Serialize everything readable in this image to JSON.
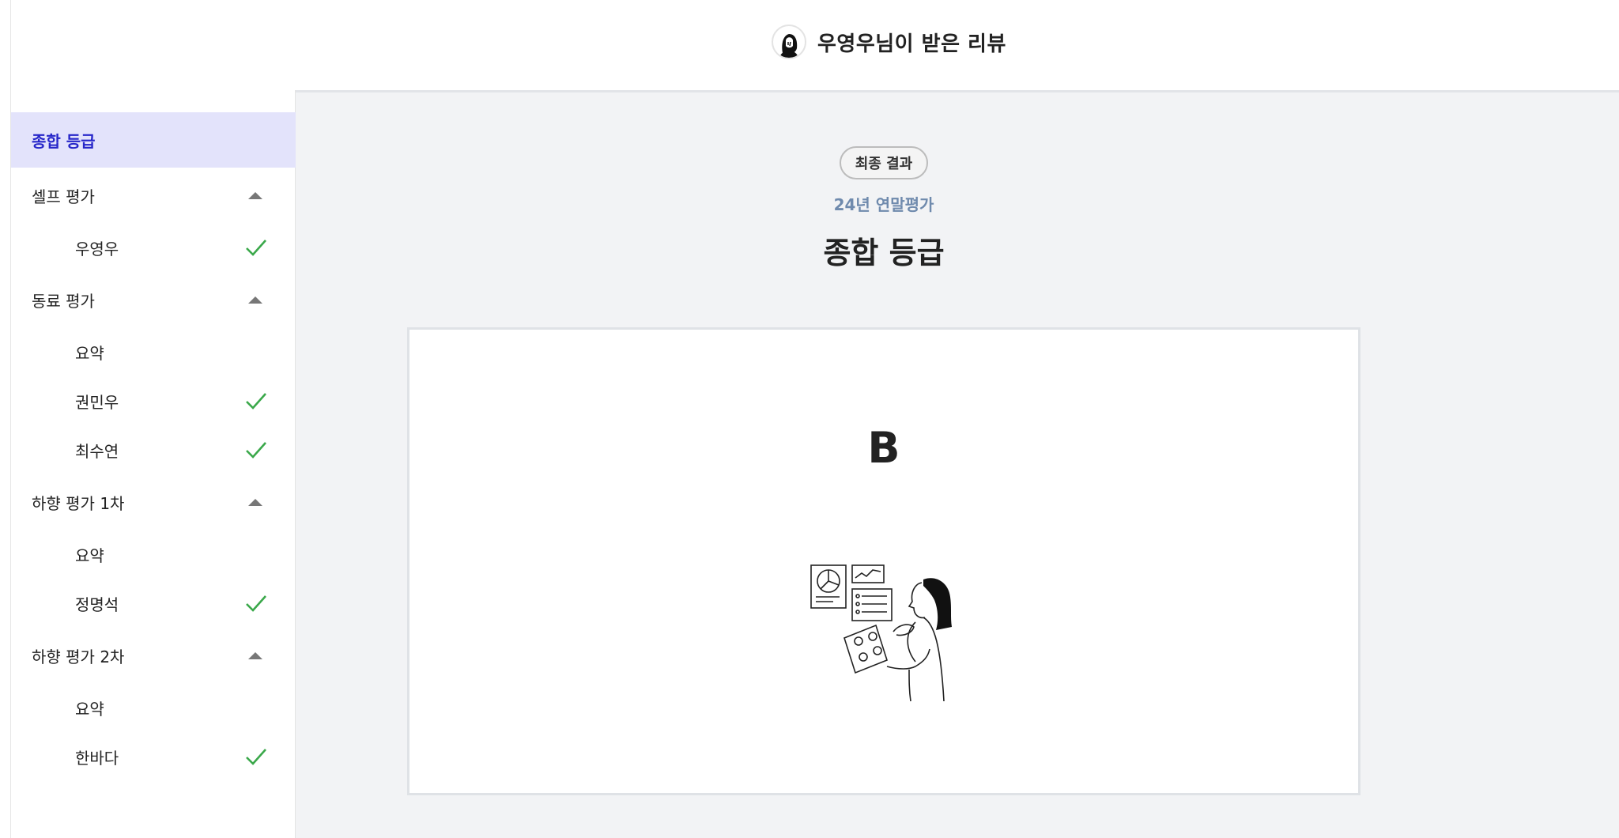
{
  "header": {
    "title": "우영우님이 받은 리뷰",
    "avatar_icon": "user-avatar-icon"
  },
  "sidebar": {
    "items": [
      {
        "label": "종합 등급",
        "type": "section",
        "active": true
      },
      {
        "label": "셀프 평가",
        "type": "group",
        "expanded": true
      },
      {
        "label": "우영우",
        "type": "sub",
        "completed": true
      },
      {
        "label": "동료 평가",
        "type": "group",
        "expanded": true
      },
      {
        "label": "요약",
        "type": "sub",
        "completed": false
      },
      {
        "label": "권민우",
        "type": "sub",
        "completed": true
      },
      {
        "label": "최수연",
        "type": "sub",
        "completed": true
      },
      {
        "label": "하향 평가 1차",
        "type": "group",
        "expanded": true
      },
      {
        "label": "요약",
        "type": "sub",
        "completed": false
      },
      {
        "label": "정명석",
        "type": "sub",
        "completed": true
      },
      {
        "label": "하향 평가 2차",
        "type": "group",
        "expanded": true
      },
      {
        "label": "요약",
        "type": "sub",
        "completed": false
      },
      {
        "label": "한바다",
        "type": "sub",
        "completed": true
      }
    ]
  },
  "main": {
    "badge": "최종 결과",
    "subtitle": "24년 연말평가",
    "title": "종합 등급",
    "grade": "B",
    "illustration_icon": "person-analyzing-reports-illustration"
  },
  "colors": {
    "accent": "#2626c9",
    "active_bg": "#e3e3fb",
    "check": "#3aa84a",
    "subtitle": "#6f8aad",
    "main_bg": "#f2f3f5"
  }
}
